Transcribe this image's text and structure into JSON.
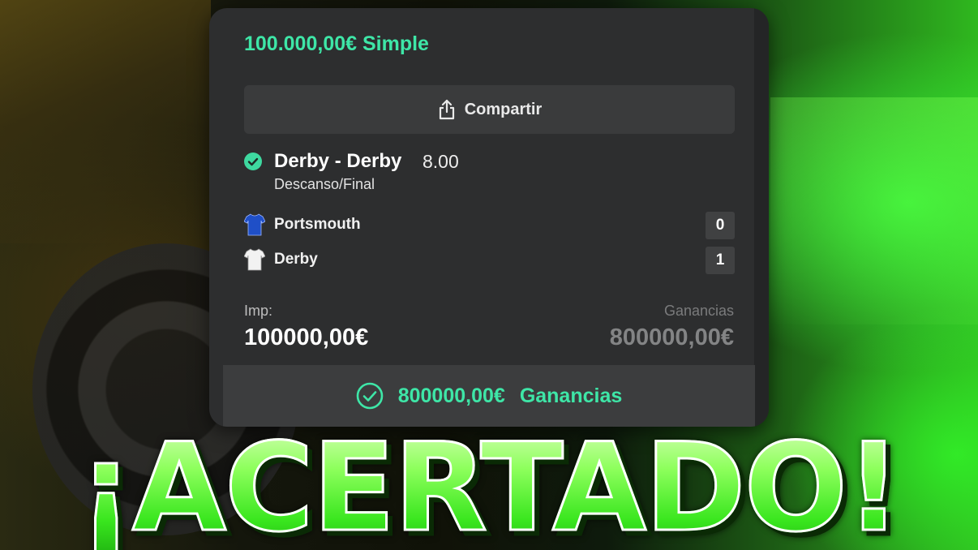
{
  "bet": {
    "title": "100.000,00€ Simple",
    "share_label": "Compartir",
    "selection": {
      "name": "Derby - Derby",
      "odds": "8.00",
      "market": "Descanso/Final"
    },
    "teams": [
      {
        "name": "Portsmouth",
        "score": "0",
        "jersey_color": "#1f4fc7"
      },
      {
        "name": "Derby",
        "score": "1",
        "jersey_color": "#f2f2f2"
      }
    ],
    "stake_label": "Imp:",
    "stake_value": "100000,00€",
    "winnings_label": "Ganancias",
    "winnings_value": "800000,00€",
    "footer": {
      "amount": "800000,00€",
      "label": "Ganancias"
    }
  },
  "headline": "¡ACERTADO!",
  "colors": {
    "accent": "#3ee6a7",
    "card_bg": "#2d2e2f",
    "headline_green": "#7dfd5a"
  },
  "icons": {
    "share": "share-icon",
    "check": "check-circle-icon",
    "footer_check": "check-circle-outline-icon",
    "jersey": "jersey-icon"
  }
}
